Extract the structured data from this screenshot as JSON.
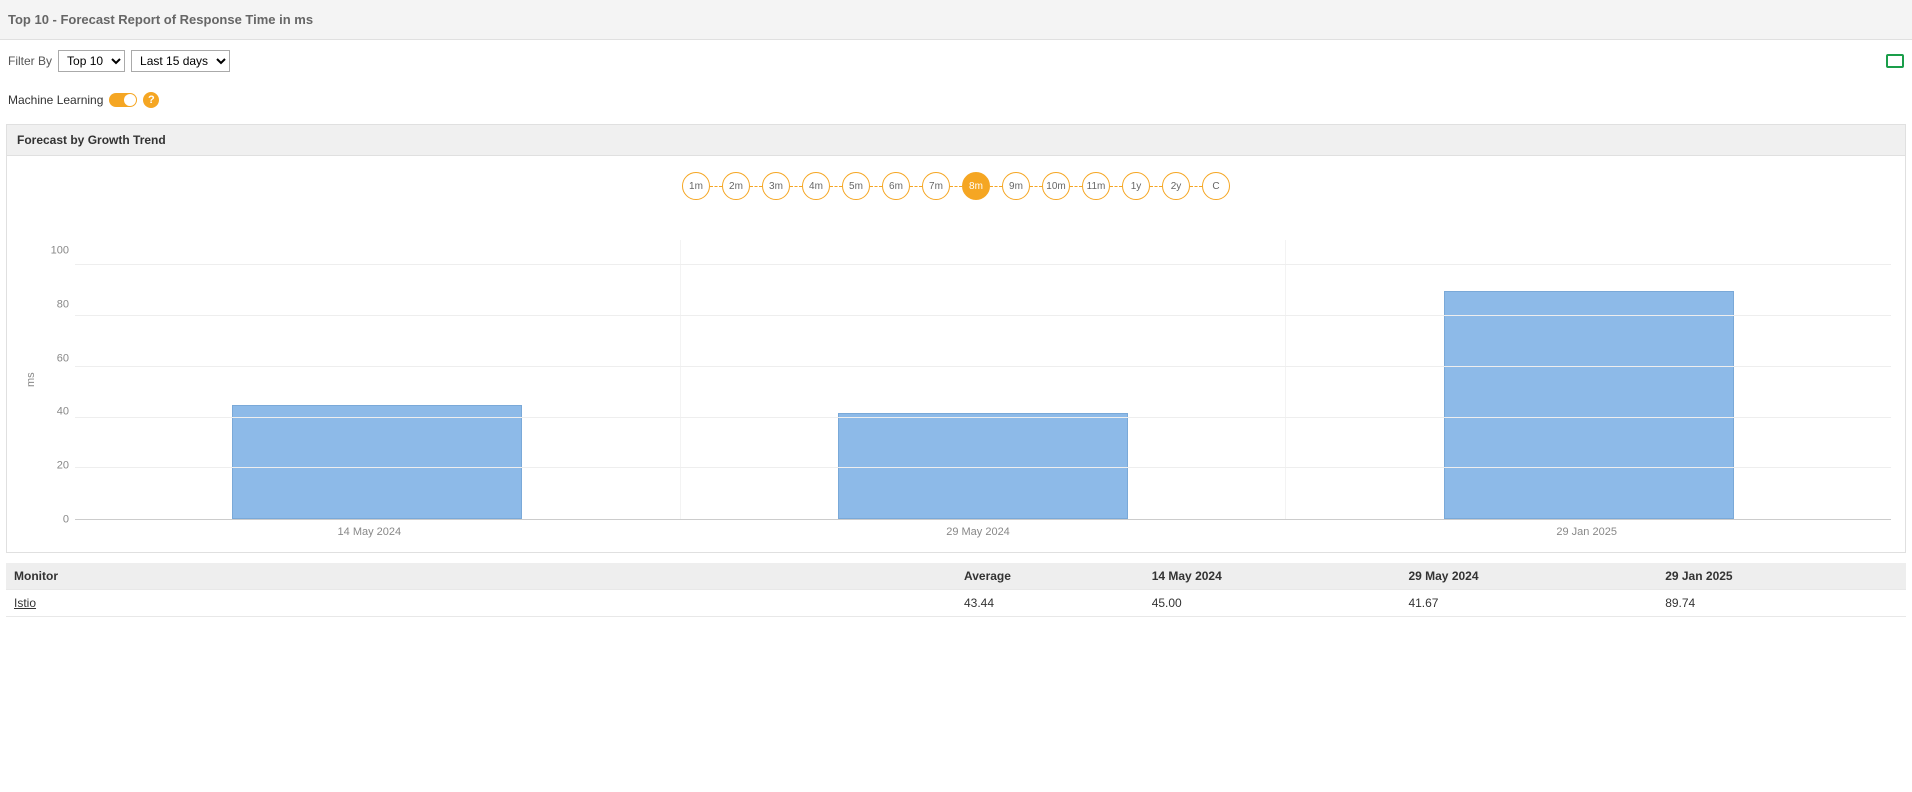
{
  "header": {
    "title": "Top 10 - Forecast Report of Response Time in ms"
  },
  "filter": {
    "label": "Filter By",
    "top_options": [
      "Top 10"
    ],
    "top_selected": "Top 10",
    "range_options": [
      "Last 15 days"
    ],
    "range_selected": "Last 15 days"
  },
  "ml": {
    "label": "Machine Learning",
    "help": "?"
  },
  "panel": {
    "title": "Forecast by Growth Trend"
  },
  "range_buttons": [
    "1m",
    "2m",
    "3m",
    "4m",
    "5m",
    "6m",
    "7m",
    "8m",
    "9m",
    "10m",
    "11m",
    "1y",
    "2y",
    "C"
  ],
  "range_active": "8m",
  "chart_data": {
    "type": "bar",
    "ylabel": "ms",
    "ylim": [
      0,
      110
    ],
    "yticks": [
      0,
      20,
      40,
      60,
      80,
      100
    ],
    "categories": [
      "14 May 2024",
      "29 May 2024",
      "29 Jan 2025"
    ],
    "values": [
      45.0,
      41.67,
      89.74
    ]
  },
  "table": {
    "headers": [
      "Monitor",
      "Average",
      "14 May 2024",
      "29 May 2024",
      "29 Jan 2025"
    ],
    "rows": [
      {
        "monitor": "Istio",
        "average": "43.44",
        "c1": "45.00",
        "c2": "41.67",
        "c3": "89.74"
      }
    ]
  }
}
